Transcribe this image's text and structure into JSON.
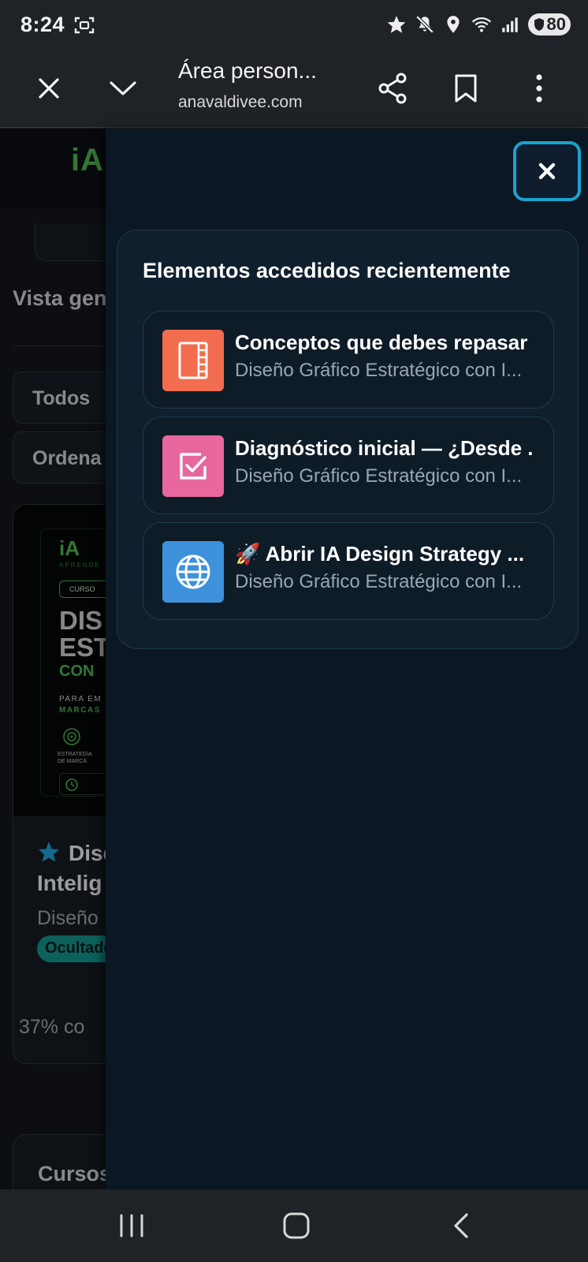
{
  "status_bar": {
    "time": "8:24",
    "battery": "80",
    "icons": [
      "screenshot-icon",
      "star-icon",
      "mute-icon",
      "location-icon",
      "wifi-icon",
      "signal-icon",
      "battery-icon"
    ]
  },
  "browser": {
    "title": "Área person...",
    "url": "anavaldivee.com",
    "icons": [
      "close-icon",
      "chevron-down-icon",
      "share-icon",
      "bookmark-icon",
      "more-vert-icon"
    ]
  },
  "background_page": {
    "logo": "iA",
    "view_heading": "Vista gen",
    "filter_label": "Todos",
    "sort_label": "Ordena",
    "course": {
      "thumbnail": {
        "logo": "iA",
        "tagline": "APRENDE",
        "badge": "CURSO",
        "headline_1": "DIS",
        "headline_2": "EST",
        "green_line": "CON",
        "audience_1": "PARA EM",
        "audience_2": "MARCAS",
        "icon_label_1": "ESTRATEGIA",
        "icon_label_2": "DE MARCA"
      },
      "title_line1": "Dise",
      "title_line2": "Intelig",
      "category": "Diseño",
      "status_badge": "Ocultado",
      "progress_text": "37% co",
      "progress": 0.37
    },
    "second_section": "Cursos"
  },
  "drawer": {
    "close_label": "×",
    "heading": "Elementos accedidos recientemente",
    "items": [
      {
        "title": "Conceptos que debes repasar",
        "subtitle": "Diseño Gráfico Estratégico con I...",
        "icon": "book-icon",
        "color": "#f26d4f"
      },
      {
        "title": "Diagnóstico inicial — ¿Desde ...",
        "subtitle": "Diseño Gráfico Estratégico con I...",
        "icon": "checkbox-icon",
        "color": "#e8679c"
      },
      {
        "title": "🚀 Abrir IA Design Strategy ...",
        "subtitle": "Diseño Gráfico Estratégico con I...",
        "icon": "globe-icon",
        "color": "#3d92db"
      }
    ]
  },
  "nav_bar": {
    "icons": [
      "recents-icon",
      "home-icon",
      "back-icon"
    ]
  }
}
